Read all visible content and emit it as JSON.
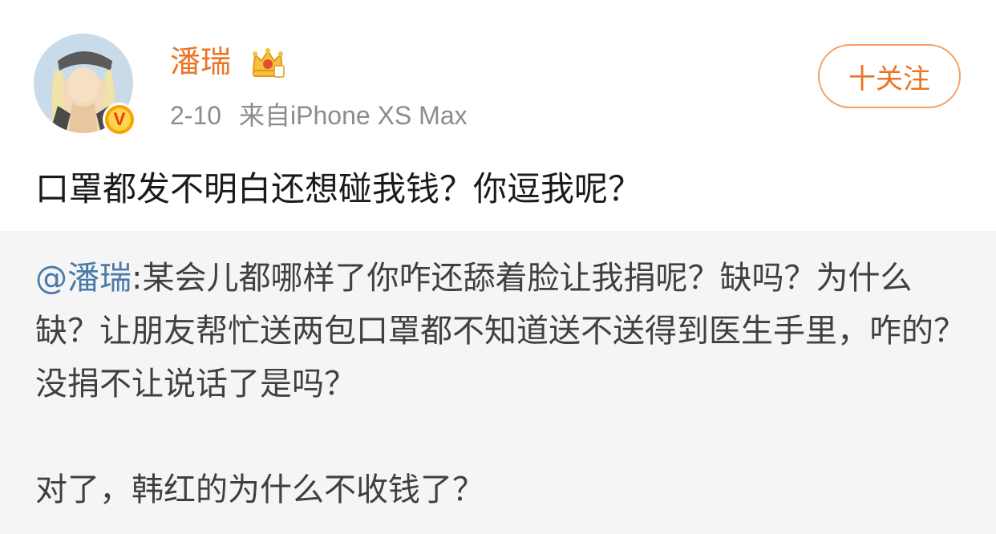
{
  "header": {
    "username": "潘瑞",
    "date": "2-10",
    "source": "来自iPhone XS Max",
    "follow_label": "十关注",
    "verified_badge": "V"
  },
  "post": {
    "text": "口罩都发不明白还想碰我钱？你逗我呢？"
  },
  "repost": {
    "mention": "@潘瑞",
    "text": ":某会儿都哪样了你咋还舔着脸让我捐呢？缺吗？为什么缺？让朋友帮忙送两包口罩都不知道送不送得到医生手里，咋的？没捐不让说话了是吗？",
    "text2": "对了，韩红的为什么不收钱了？"
  },
  "colors": {
    "accent": "#eb7325",
    "mention": "#4a7aa8",
    "repost_bg": "#f5f5f5"
  },
  "icons": {
    "badge": "verified-v-icon",
    "level": "crown-icon"
  }
}
